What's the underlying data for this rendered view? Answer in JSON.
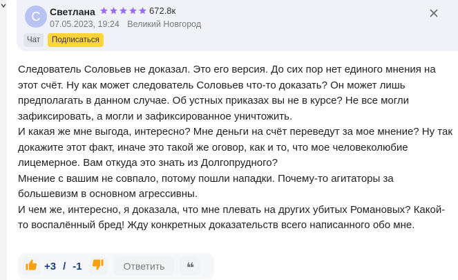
{
  "comment": {
    "author": {
      "initial": "С",
      "name": "Светлана",
      "stars": 5,
      "rating": "672.8к"
    },
    "meta": {
      "date": "07.05.2023, 19:24",
      "location": "Великий Новгород"
    },
    "chips": {
      "chat": "Чат",
      "subscribe": "Подписаться"
    },
    "paragraphs": [
      "Следователь Соловьев не доказал. Это его версия. До сих пор нет единого мнения на этот счёт. Ну как может следователь Соловьев что-то доказать? Он может лишь предполагать в данном случае. Об устных приказах вы не в курсе? Не все могли зафиксировать, а могли и зафиксированное уничтожить.",
      "И какая же мне выгода, интересно? Мне деньги на счёт переведут за мое мнение? Ну так докажите этот факт, иначе это такой же оговор, как и то, что мое человеколюбие лицемерное. Вам откуда это знать из Долгопрудного?",
      "Мнение с вашим не совпало, потому пошли нападки. Почему-то агитаторы за большевизм в основном агрессивны.",
      "И чем же, интересно, я доказала, что мне плевать на других убитых Романовых? Какой-то воспалённый бред! Жду конкретных доказательств всего написанного обо мне."
    ],
    "footer": {
      "likes": "+3",
      "separator": "/",
      "dislikes": "-1",
      "reply_label": "Ответить",
      "quote_glyph": "❝"
    }
  },
  "colors": {
    "header_bg": "#f0f2f8",
    "avatar_bg": "#b9c3f2",
    "star": "#9b6cf2",
    "subscribe_bg": "#ffd43b",
    "icon_orange": "#f7a10c",
    "vote_text": "#1a3d7c"
  },
  "icons": {
    "close": "close-icon",
    "like": "thumbs-up-icon",
    "dislike": "thumbs-down-icon",
    "quote": "quote-icon"
  }
}
